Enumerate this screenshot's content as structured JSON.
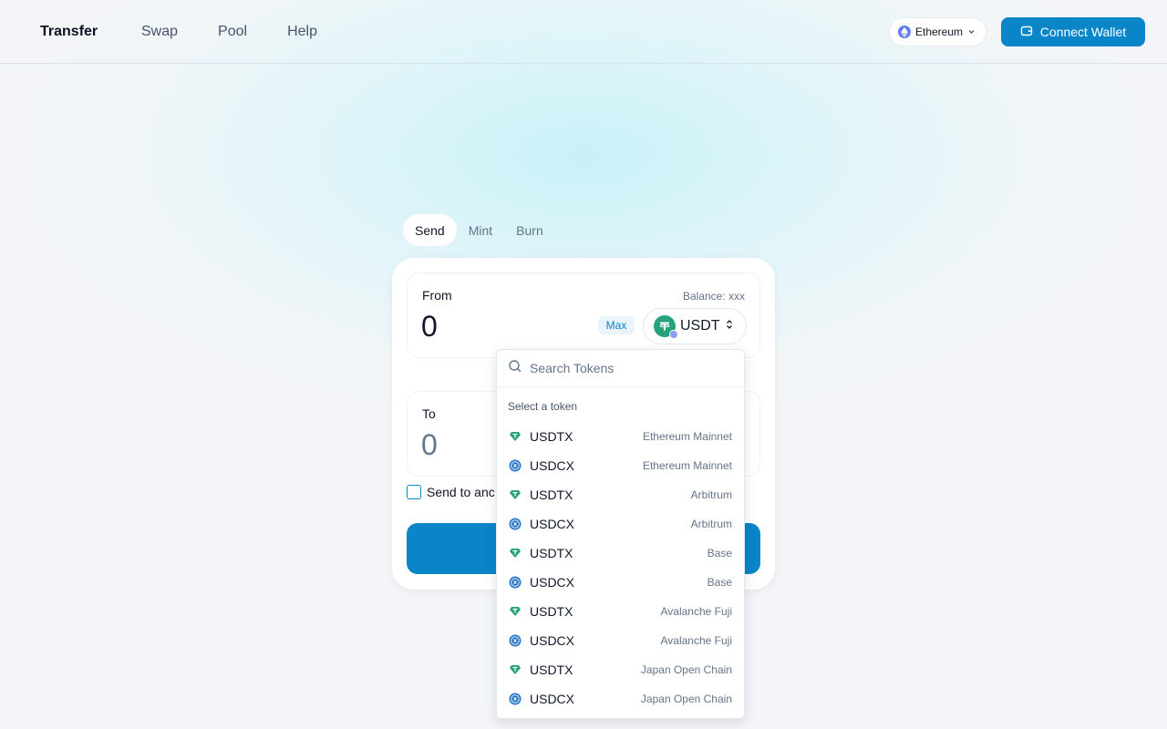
{
  "header": {
    "brand": "Transfer",
    "nav": [
      "Swap",
      "Pool",
      "Help"
    ],
    "network": "Ethereum",
    "connect_label": "Connect Wallet"
  },
  "tabs": [
    "Send",
    "Mint",
    "Burn"
  ],
  "from": {
    "label": "From",
    "balance": "Balance: xxx",
    "amount": "0",
    "max_label": "Max",
    "token": "USDT"
  },
  "to": {
    "label": "To",
    "amount": "0"
  },
  "send_other_label": "Send to anc",
  "dropdown": {
    "search_placeholder": "Search Tokens",
    "heading": "Select a token",
    "items": [
      {
        "name": "USDTX",
        "network": "Ethereum Mainnet",
        "icon": "usdt-icon"
      },
      {
        "name": "USDCX",
        "network": "Ethereum Mainnet",
        "icon": "usdc-icon"
      },
      {
        "name": "USDTX",
        "network": "Arbitrum",
        "icon": "usdt-icon"
      },
      {
        "name": "USDCX",
        "network": "Arbitrum",
        "icon": "usdc-icon"
      },
      {
        "name": "USDTX",
        "network": "Base",
        "icon": "usdt-icon"
      },
      {
        "name": "USDCX",
        "network": "Base",
        "icon": "usdc-icon"
      },
      {
        "name": "USDTX",
        "network": "Avalanche Fuji",
        "icon": "usdt-icon"
      },
      {
        "name": "USDCX",
        "network": "Avalanche Fuji",
        "icon": "usdc-icon"
      },
      {
        "name": "USDTX",
        "network": "Japan Open Chain",
        "icon": "usdt-icon"
      },
      {
        "name": "USDCX",
        "network": "Japan Open Chain",
        "icon": "usdc-icon"
      }
    ]
  },
  "colors": {
    "primary": "#0a85c8",
    "usdt": "#26a17b",
    "usdc": "#2775ca",
    "eth": "#627eea"
  }
}
